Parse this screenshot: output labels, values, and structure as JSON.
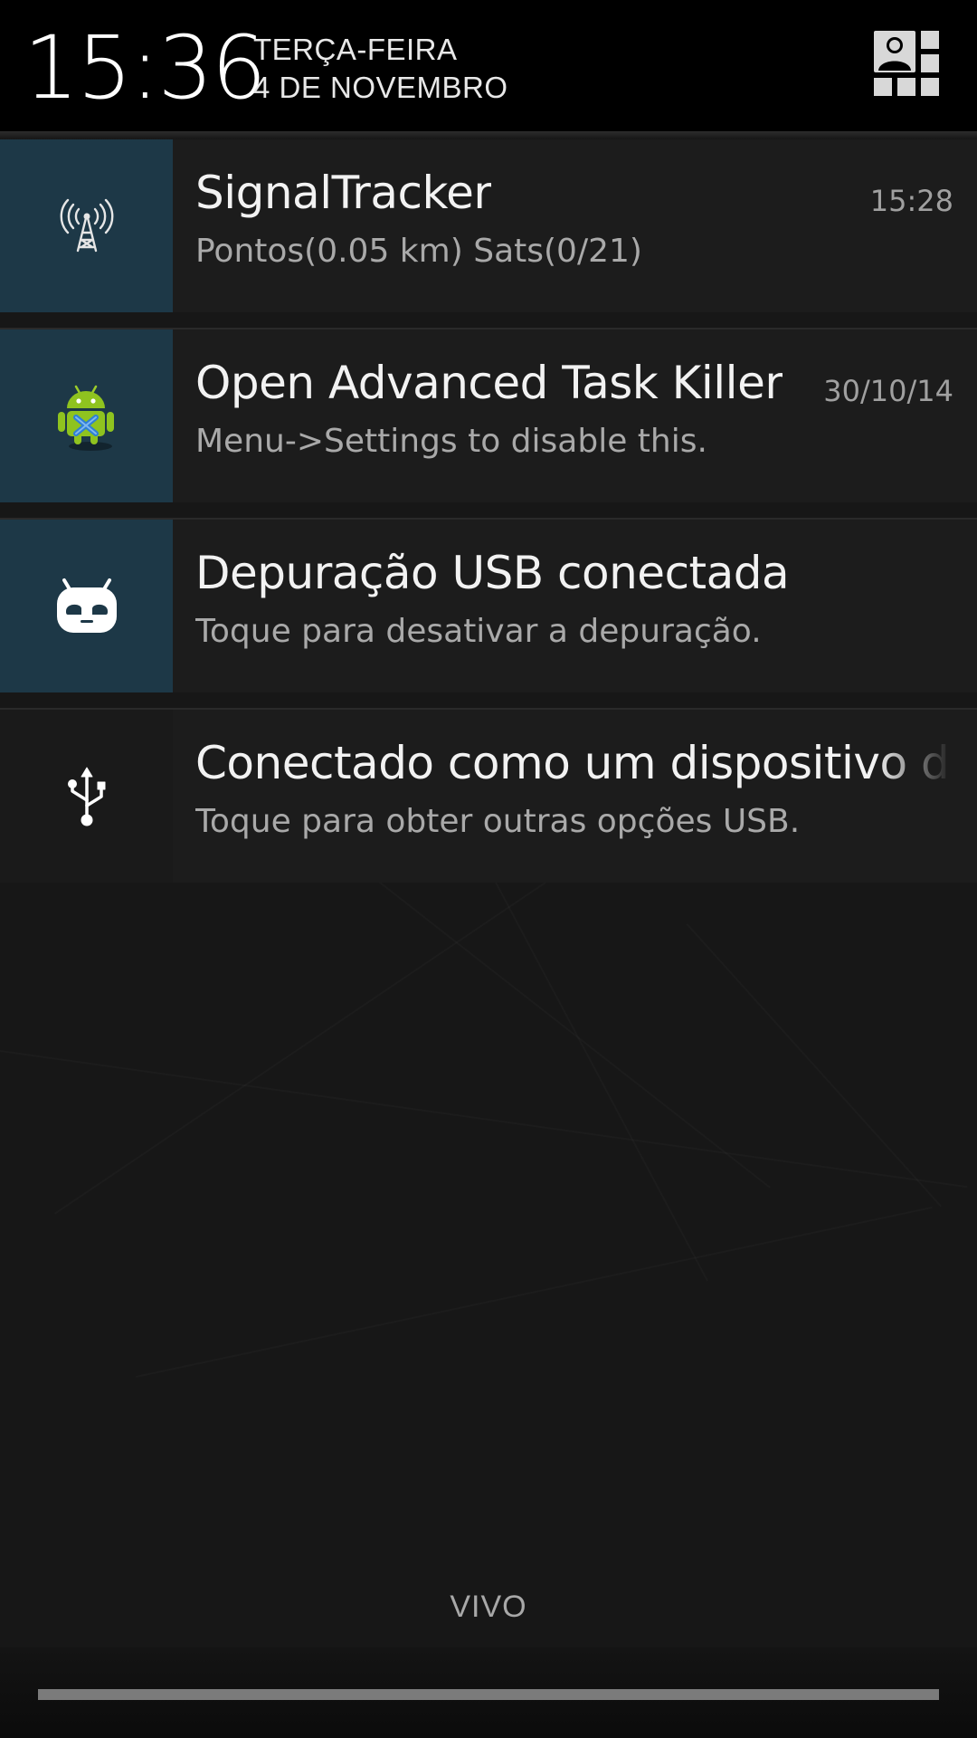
{
  "status_header": {
    "time": "15:36",
    "weekday": "TERÇA-FEIRA",
    "date": "4 DE NOVEMBRO",
    "quick_settings_icon": "user-grid-icon"
  },
  "notifications": [
    {
      "app_icon": "antenna-tower-icon",
      "title": "SignalTracker",
      "text": "Pontos(0.05 km) Sats(0/21)",
      "time": "15:28"
    },
    {
      "app_icon": "android-robot-icon",
      "title": "Open Advanced Task Killer",
      "text": "Menu->Settings to disable this.",
      "time": "30/10/14"
    },
    {
      "app_icon": "cyanogenmod-bugdroid-icon",
      "title": "Depuração USB conectada",
      "text": "Toque para desativar a depuração."
    },
    {
      "app_icon": "usb-icon",
      "title": "Conectado como um dispositivo de",
      "text": "Toque para obter outras opções USB."
    }
  ],
  "carrier": "VIVO",
  "colors": {
    "header_bg": "#000000",
    "shade_bg": "#171717",
    "notification_bg": "#1c1c1c",
    "icon_box_bg": "#1d3847",
    "title_text": "#f2f2f2",
    "secondary_text": "#a9a9a9"
  }
}
